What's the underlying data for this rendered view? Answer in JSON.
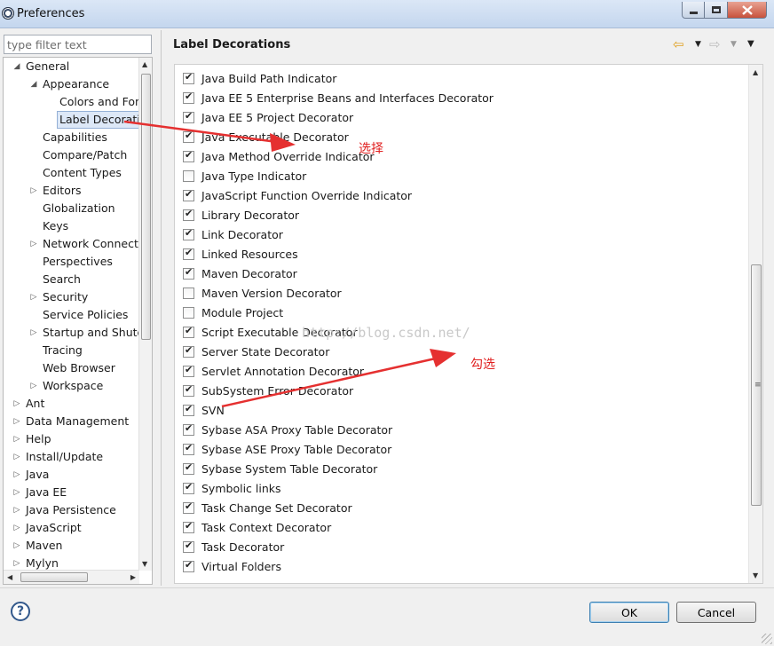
{
  "window": {
    "title": "Preferences"
  },
  "filter": {
    "placeholder": "type filter text",
    "value": ""
  },
  "tree": {
    "items": [
      {
        "label": "General",
        "level": 0,
        "expander": "expanded"
      },
      {
        "label": "Appearance",
        "level": 1,
        "expander": "expanded"
      },
      {
        "label": "Colors and Fonts",
        "level": 2,
        "expander": "none"
      },
      {
        "label": "Label Decorations",
        "level": 2,
        "expander": "none",
        "selected": true
      },
      {
        "label": "Capabilities",
        "level": 1,
        "expander": "none"
      },
      {
        "label": "Compare/Patch",
        "level": 1,
        "expander": "none"
      },
      {
        "label": "Content Types",
        "level": 1,
        "expander": "none"
      },
      {
        "label": "Editors",
        "level": 1,
        "expander": "collapsed"
      },
      {
        "label": "Globalization",
        "level": 1,
        "expander": "none"
      },
      {
        "label": "Keys",
        "level": 1,
        "expander": "none"
      },
      {
        "label": "Network Connections",
        "level": 1,
        "expander": "collapsed"
      },
      {
        "label": "Perspectives",
        "level": 1,
        "expander": "none"
      },
      {
        "label": "Search",
        "level": 1,
        "expander": "none"
      },
      {
        "label": "Security",
        "level": 1,
        "expander": "collapsed"
      },
      {
        "label": "Service Policies",
        "level": 1,
        "expander": "none"
      },
      {
        "label": "Startup and Shutdown",
        "level": 1,
        "expander": "collapsed"
      },
      {
        "label": "Tracing",
        "level": 1,
        "expander": "none"
      },
      {
        "label": "Web Browser",
        "level": 1,
        "expander": "none"
      },
      {
        "label": "Workspace",
        "level": 1,
        "expander": "collapsed"
      },
      {
        "label": "Ant",
        "level": 0,
        "expander": "collapsed"
      },
      {
        "label": "Data Management",
        "level": 0,
        "expander": "collapsed"
      },
      {
        "label": "Help",
        "level": 0,
        "expander": "collapsed"
      },
      {
        "label": "Install/Update",
        "level": 0,
        "expander": "collapsed"
      },
      {
        "label": "Java",
        "level": 0,
        "expander": "collapsed"
      },
      {
        "label": "Java EE",
        "level": 0,
        "expander": "collapsed"
      },
      {
        "label": "Java Persistence",
        "level": 0,
        "expander": "collapsed"
      },
      {
        "label": "JavaScript",
        "level": 0,
        "expander": "collapsed"
      },
      {
        "label": "Maven",
        "level": 0,
        "expander": "collapsed"
      },
      {
        "label": "Mylyn",
        "level": 0,
        "expander": "collapsed"
      }
    ]
  },
  "page": {
    "title": "Label Decorations"
  },
  "decorators": [
    {
      "label": "Java Build Path Indicator",
      "checked": true
    },
    {
      "label": "Java EE 5 Enterprise Beans and Interfaces Decorator",
      "checked": true
    },
    {
      "label": "Java EE 5 Project Decorator",
      "checked": true
    },
    {
      "label": "Java Executable Decorator",
      "checked": true
    },
    {
      "label": "Java Method Override Indicator",
      "checked": true
    },
    {
      "label": "Java Type Indicator",
      "checked": false
    },
    {
      "label": "JavaScript Function Override Indicator",
      "checked": true
    },
    {
      "label": "Library Decorator",
      "checked": true
    },
    {
      "label": "Link Decorator",
      "checked": true
    },
    {
      "label": "Linked Resources",
      "checked": true
    },
    {
      "label": "Maven Decorator",
      "checked": true
    },
    {
      "label": "Maven Version Decorator",
      "checked": false
    },
    {
      "label": "Module Project",
      "checked": false
    },
    {
      "label": "Script Executable Decorator",
      "checked": true
    },
    {
      "label": "Server State Decorator",
      "checked": true
    },
    {
      "label": "Servlet Annotation Decorator",
      "checked": true
    },
    {
      "label": "SubSystem Error Decorator",
      "checked": true
    },
    {
      "label": "SVN",
      "checked": true
    },
    {
      "label": "Sybase ASA Proxy Table Decorator",
      "checked": true
    },
    {
      "label": "Sybase ASE Proxy Table Decorator",
      "checked": true
    },
    {
      "label": "Sybase System Table Decorator",
      "checked": true
    },
    {
      "label": "Symbolic links",
      "checked": true
    },
    {
      "label": "Task Change Set Decorator",
      "checked": true
    },
    {
      "label": "Task Context Decorator",
      "checked": true
    },
    {
      "label": "Task Decorator",
      "checked": true
    },
    {
      "label": "Virtual Folders",
      "checked": true
    }
  ],
  "watermark": "http://blog.csdn.net/",
  "annotations": {
    "select": "选择",
    "check": "勾选",
    "color": "#e02020"
  },
  "buttons": {
    "ok": "OK",
    "cancel": "Cancel",
    "help": "?"
  },
  "icons": {
    "back": "back-arrow-icon",
    "forward": "forward-arrow-icon",
    "menu": "view-menu-icon",
    "help": "help-icon"
  },
  "colors": {
    "selection": "#dde8f7",
    "back_arrow": "#e0a020",
    "forward_arrow": "#bdbdbd"
  }
}
